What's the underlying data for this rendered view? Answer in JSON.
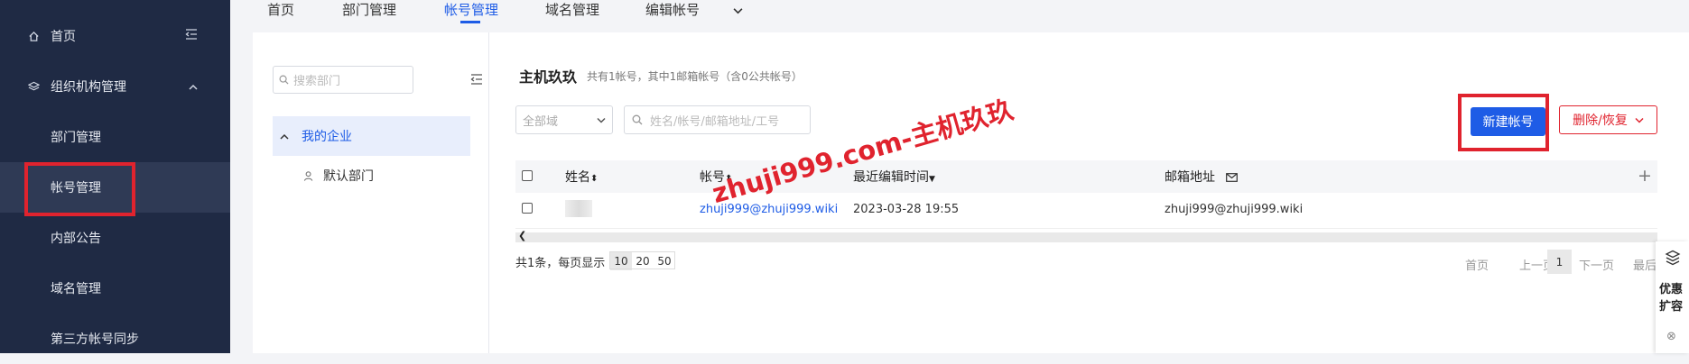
{
  "sidebar": {
    "home": "首页",
    "org": "组织机构管理",
    "dept_mgmt": "部门管理",
    "account_mgmt": "帐号管理",
    "notice": "内部公告",
    "domain_mgmt": "域名管理",
    "third_sync": "第三方帐号同步"
  },
  "tabs": [
    "首页",
    "部门管理",
    "帐号管理",
    "域名管理",
    "编辑帐号"
  ],
  "dept_panel": {
    "search_placeholder": "搜索部门",
    "root": "我的企业",
    "child": "默认部门"
  },
  "main": {
    "title": "主机玖玖",
    "summary": "共有1帐号，其中1邮箱帐号（含0公共帐号）",
    "domain_select": "全部域",
    "search_placeholder": "姓名/帐号/邮箱地址/工号",
    "new_button": "新建帐号",
    "delete_button": "删除/恢复"
  },
  "table": {
    "columns": [
      "姓名",
      "帐号",
      "最近编辑时间",
      "邮箱地址"
    ],
    "rows": [
      {
        "name": "",
        "account": "zhuji999@zhuji999.wiki",
        "edited": "2023-03-28 19:55",
        "email": "zhuji999@zhuji999.wiki"
      }
    ]
  },
  "pagination": {
    "total": "共1条，每页显示",
    "sizes": [
      "10",
      "20",
      "50"
    ],
    "first": "首页",
    "prev": "上一页",
    "current": "1",
    "next": "下一页",
    "last": "最后"
  },
  "float_panel": {
    "line1": "优惠",
    "line2": "扩容"
  },
  "watermark": "zhuji999.com-主机玖玖"
}
